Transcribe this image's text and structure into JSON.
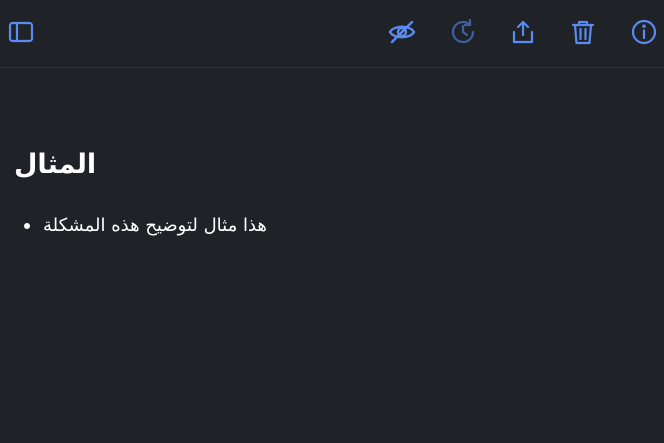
{
  "toolbar": {
    "accent_color": "#5b8af0",
    "disabled_color": "#3f5f9f",
    "buttons": [
      {
        "icon": "sidebar-toggle-icon"
      },
      {
        "icon": "eye-slash-icon"
      },
      {
        "icon": "history-icon"
      },
      {
        "icon": "share-icon"
      },
      {
        "icon": "trash-icon"
      },
      {
        "icon": "info-icon"
      }
    ]
  },
  "note": {
    "title": "المثال",
    "items": [
      "هذا مثال لتوضيح هذه المشكلة"
    ]
  }
}
